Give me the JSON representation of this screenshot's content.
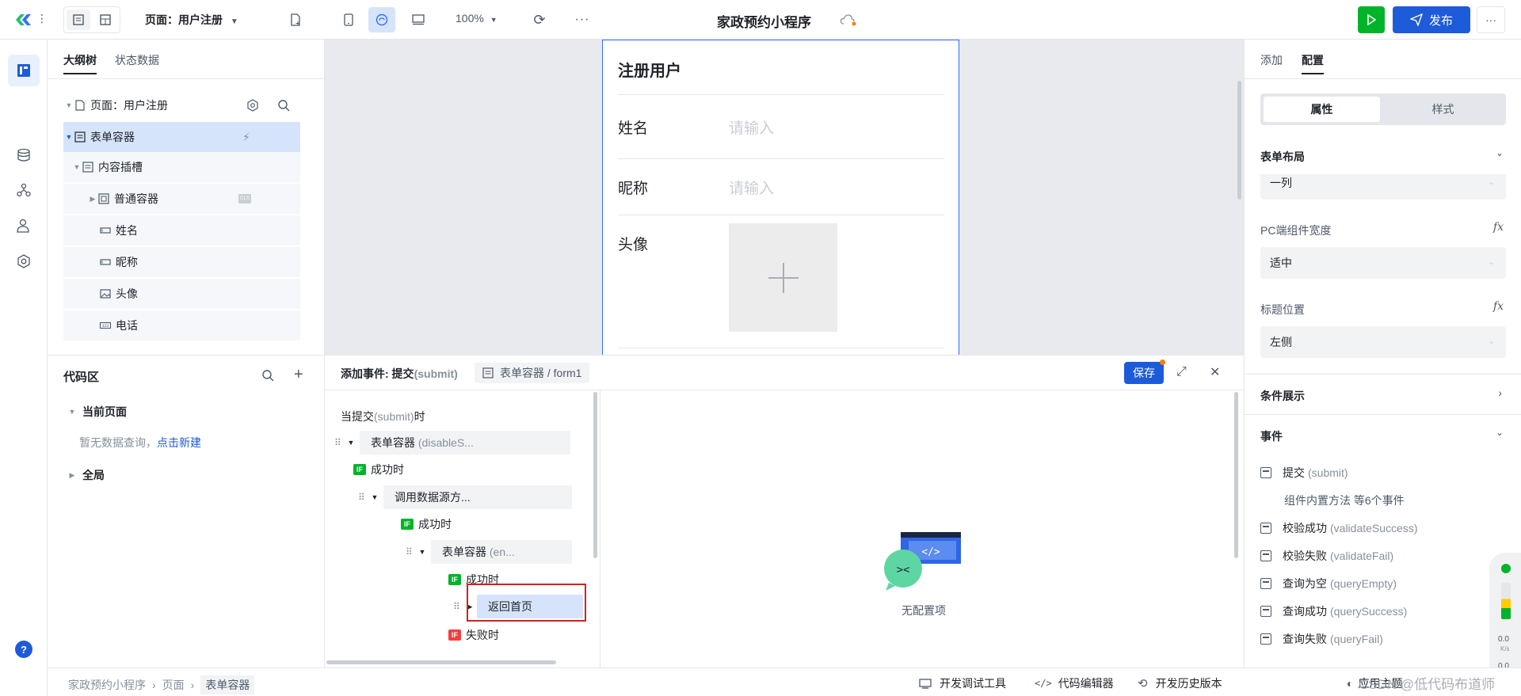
{
  "topbar": {
    "page_selector": "页面：用户注册",
    "zoom": "100%",
    "app_title": "家政预约小程序",
    "publish": "发布"
  },
  "outline": {
    "tabs": [
      "大纲树",
      "状态数据"
    ],
    "items": [
      {
        "label": "页面：用户注册"
      },
      {
        "label": "表单容器"
      },
      {
        "label": "内容插槽"
      },
      {
        "label": "普通容器"
      },
      {
        "label": "姓名"
      },
      {
        "label": "昵称"
      },
      {
        "label": "头像"
      },
      {
        "label": "电话"
      }
    ]
  },
  "phone": {
    "title": "注册用户",
    "fields": [
      {
        "label": "姓名",
        "placeholder": "请输入"
      },
      {
        "label": "昵称",
        "placeholder": "请输入"
      },
      {
        "label": "头像"
      }
    ]
  },
  "right": {
    "tabs": [
      "添加",
      "配置"
    ],
    "segments": [
      "属性",
      "样式"
    ],
    "form_layout": {
      "title": "表单布局",
      "value": "一列"
    },
    "pc_width": {
      "label": "PC端组件宽度",
      "value": "适中"
    },
    "title_pos": {
      "label": "标题位置",
      "value": "左侧"
    },
    "fx": "fx",
    "conditional": "条件展示",
    "events_title": "事件",
    "events": [
      {
        "name": "提交",
        "en": "(submit)"
      },
      {
        "name": "校验成功",
        "en": "(validateSuccess)"
      },
      {
        "name": "校验失败",
        "en": "(validateFail)"
      },
      {
        "name": "查询为空",
        "en": "(queryEmpty)"
      },
      {
        "name": "查询成功",
        "en": "(querySuccess)"
      },
      {
        "name": "查询失败",
        "en": "(queryFail)"
      }
    ],
    "builtin": "组件内置方法 等6个事件"
  },
  "code": {
    "title": "代码区",
    "current_page": "当前页面",
    "empty_text": "暂无数据查询，",
    "create_link": "点击新建",
    "global": "全局"
  },
  "event_editor": {
    "header_title": "添加事件: 提交",
    "header_en": "(submit)",
    "breadcrumb": "表单容器 / form1",
    "save": "保存",
    "trigger": "当提交",
    "trigger_en": "(submit)",
    "trigger_suffix": "时",
    "node1": "表单容器",
    "node1_en": " (disableS...",
    "success": "成功时",
    "node2": "调用数据源方...",
    "node3": "表单容器",
    "node3_en": " (en...",
    "node4": "返回首页",
    "fail": "失败时",
    "if_label": "IF",
    "empty_config": "无配置项"
  },
  "statusbar": {
    "crumbs": [
      "家政预约小程序",
      "页面",
      "表单容器"
    ],
    "dev_tools": "开发调试工具",
    "code_editor": "代码编辑器",
    "history": "开发历史版本",
    "app_theme": "应用主题",
    "watermark": "CSDN @低代码布道师"
  },
  "side_widget": {
    "speed1": "0.0",
    "unit1": "K/s",
    "speed2": "0.0"
  }
}
